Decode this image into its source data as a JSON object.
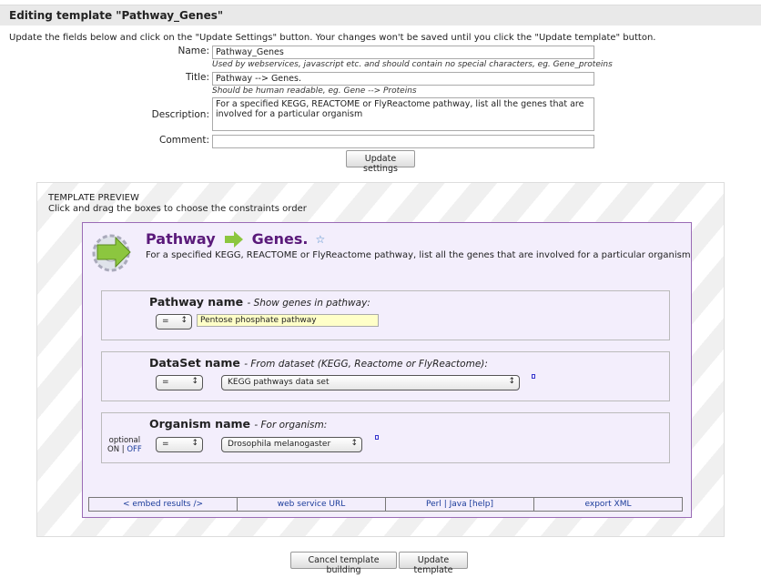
{
  "header": {
    "title": "Editing template \"Pathway_Genes\""
  },
  "intro": "Update the fields below and click on the \"Update Settings\" button. Your changes won't be saved until you click the \"Update template\" button.",
  "form": {
    "name_label": "Name:",
    "name_value": "Pathway_Genes",
    "name_hint": "Used by webservices, javascript etc. and should contain no special characters, eg. Gene_proteins",
    "title_label": "Title:",
    "title_value": "Pathway --> Genes.",
    "title_hint": "Should be human readable, eg. Gene --> Proteins",
    "description_label": "Description:",
    "description_value": "For a specified KEGG, REACTOME or FlyReactome pathway, list all the genes that are involved for a particular organism",
    "comment_label": "Comment:",
    "comment_value": "",
    "update_settings": "Update settings"
  },
  "preview": {
    "heading": "TEMPLATE PREVIEW",
    "subheading": "Click and drag the boxes to choose the constraints order",
    "title_from": "Pathway",
    "title_to": "Genes.",
    "description": "For a specified KEGG, REACTOME or FlyReactome pathway, list all the genes that are involved for a particular organism",
    "constraints": [
      {
        "name": "Pathway name",
        "desc": "- Show genes in pathway:",
        "op": "=",
        "value": "Pentose phosphate pathway"
      },
      {
        "name": "DataSet name",
        "desc": "- From dataset (KEGG, Reactome or FlyReactome):",
        "op": "=",
        "value": "KEGG pathways data set"
      },
      {
        "name": "Organism name",
        "desc": "- For organism:",
        "op": "=",
        "value": "Drosophila melanogaster",
        "optional": "optional",
        "on": "ON",
        "sep": "|",
        "off": "OFF"
      }
    ],
    "footer": [
      "< embed results />",
      "web service URL",
      "Perl | Java [help]",
      "export XML"
    ]
  },
  "actions": {
    "cancel": "Cancel template building",
    "update": "Update template"
  },
  "colors": {
    "title_purple": "#5a1a7a",
    "card_bg": "#f3eefc",
    "input_highlight": "#ffffc8",
    "link": "#1a3b9a"
  }
}
